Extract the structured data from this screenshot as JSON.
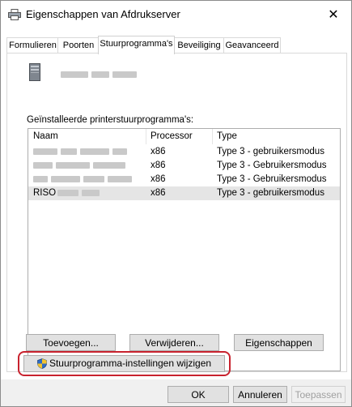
{
  "window": {
    "title": "Eigenschappen van Afdrukserver",
    "close_symbol": "✕"
  },
  "tabs": [
    {
      "label": "Formulieren"
    },
    {
      "label": "Poorten"
    },
    {
      "label": "Stuurprogramma's"
    },
    {
      "label": "Beveiliging"
    },
    {
      "label": "Geavanceerd"
    }
  ],
  "active_tab": "Stuurprogramma's",
  "drivers_section": {
    "label": "Geïnstalleerde printerstuurprogramma's:",
    "columns": [
      "Naam",
      "Processor",
      "Type"
    ],
    "rows": [
      {
        "name": "",
        "processor": "x86",
        "type": "Type 3 - gebruikersmodus"
      },
      {
        "name": "",
        "processor": "x86",
        "type": "Type 3 - Gebruikersmodus"
      },
      {
        "name": "",
        "processor": "x86",
        "type": "Type 3 - Gebruikersmodus"
      },
      {
        "name": "RISO",
        "processor": "x86",
        "type": "Type 3 - gebruikersmodus"
      }
    ]
  },
  "actions": {
    "add": "Toevoegen...",
    "remove": "Verwijderen...",
    "properties": "Eigenschappen",
    "change_settings": "Stuurprogramma-instellingen wijzigen"
  },
  "footer": {
    "ok": "OK",
    "cancel": "Annuleren",
    "apply": "Toepassen"
  },
  "colors": {
    "highlight": "#c8222e",
    "selected_row": "#e5e5e5"
  },
  "icons": {
    "title": "printer-icon",
    "server": "server-tower-icon",
    "shield": "uac-shield-icon"
  }
}
